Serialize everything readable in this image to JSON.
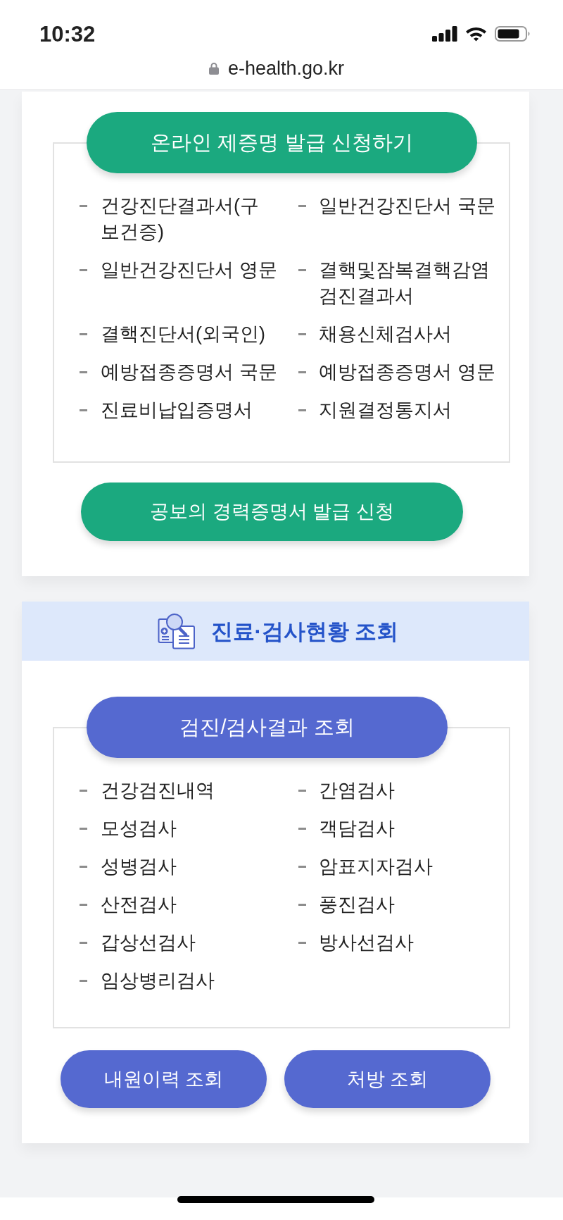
{
  "status_bar": {
    "time": "10:32"
  },
  "address_bar": {
    "url": "e-health.go.kr"
  },
  "certificate_card": {
    "title_button": "온라인 제증명 발급 신청하기",
    "links": [
      "건강진단결과서(구보건증)",
      "일반건강진단서 국문",
      "일반건강진단서 영문",
      "결핵및잠복결핵감염검진결과서",
      "결핵진단서(외국인)",
      "채용신체검사서",
      "예방접종증명서 국문",
      "예방접종증명서 영문",
      "진료비납입증명서",
      "지원결정통지서"
    ],
    "buttons": [
      "공보의 경력증명서 발급 신청"
    ]
  },
  "inquiry_card": {
    "heading": "진료·검사현황 조회",
    "title_button": "검진/검사결과 조회",
    "links": [
      "건강검진내역",
      "간염검사",
      "모성검사",
      "객담검사",
      "성병검사",
      "암표지자검사",
      "산전검사",
      "풍진검사",
      "갑상선검사",
      "방사선검사",
      "임상병리검사"
    ],
    "buttons": [
      "내원이력 조회",
      "처방 조회"
    ]
  }
}
